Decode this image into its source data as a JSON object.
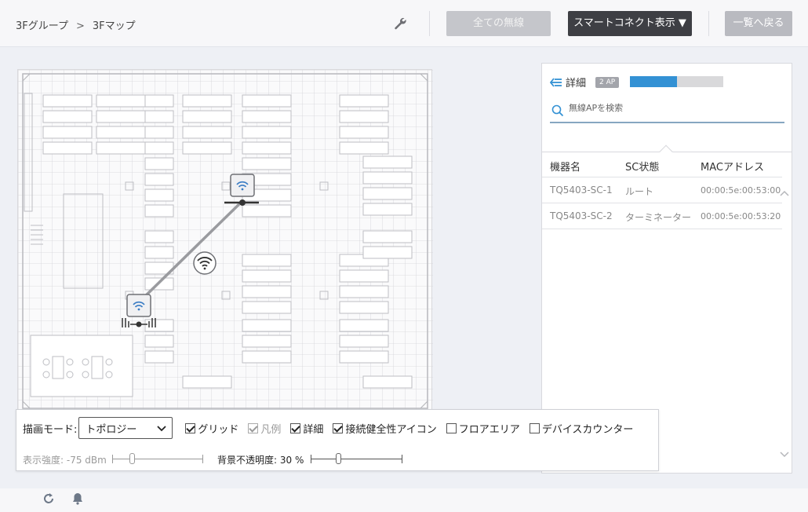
{
  "header": {
    "breadcrumb": {
      "group": "3Fグループ",
      "separator": ">",
      "map": "3Fマップ"
    },
    "all_wireless_label": "全ての無線",
    "smart_connect_label": "スマートコネクト表示 ▼",
    "back_to_list_label": "一覧へ戻る"
  },
  "map": {
    "nodes": [
      {
        "status": "root"
      },
      {
        "status": "terminator"
      }
    ],
    "icons": [
      "wrench-icon",
      "wifi-access-point-icon",
      "wifi-signal-icon"
    ]
  },
  "panel": {
    "detail_label": "詳細",
    "ap_count_badge": "2 AP",
    "progress_fraction": 0.5,
    "search_placeholder": "無線APを検索",
    "columns": [
      "機器名",
      "SC状態",
      "MACアドレス"
    ],
    "rows": [
      {
        "name": "TQ5403-SC-1",
        "state": "ルート",
        "mac": "00:00:5e:00:53:00"
      },
      {
        "name": "TQ5403-SC-2",
        "state": "ターミネーター",
        "mac": "00:00:5e:00:53:20"
      }
    ]
  },
  "controls": {
    "draw_mode_label": "描画モード:",
    "draw_mode_value": "トポロジー",
    "checkboxes": [
      {
        "label": "グリッド",
        "checked": true,
        "enabled": true
      },
      {
        "label": "凡例",
        "checked": true,
        "enabled": false
      },
      {
        "label": "詳細",
        "checked": true,
        "enabled": true
      },
      {
        "label": "接続健全性アイコン",
        "checked": true,
        "enabled": true
      },
      {
        "label": "フロアエリア",
        "checked": false,
        "enabled": true
      },
      {
        "label": "デバイスカウンター",
        "checked": false,
        "enabled": true
      }
    ],
    "display_strength_label": "表示強度: -75 dBm",
    "display_strength_enabled": false,
    "bg_opacity_label": "背景不透明度: 30 %",
    "bg_opacity_value": 0.3
  },
  "footer": {
    "icons": [
      "refresh-icon",
      "bell-icon"
    ]
  },
  "colors": {
    "accent": "#3391d4",
    "dark_button": "#3e3f44",
    "disabled_button": "#c5c6cb"
  }
}
